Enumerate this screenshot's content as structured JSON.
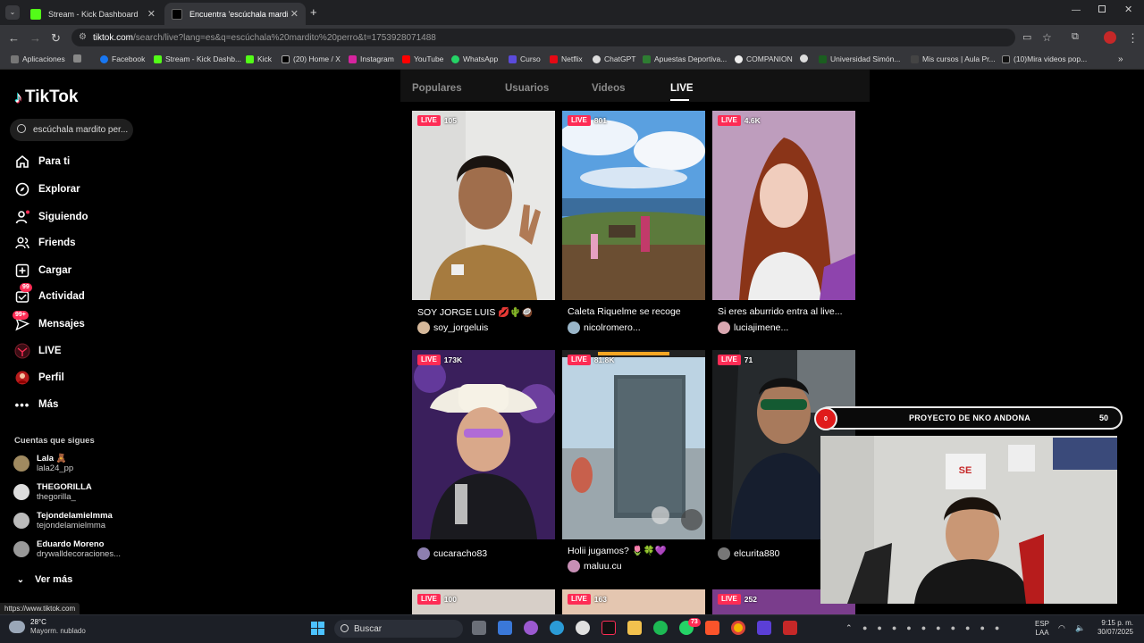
{
  "browser": {
    "tabs": [
      {
        "title": "Stream - Kick Dashboard",
        "active": false
      },
      {
        "title": "Encuentra 'escúchala mardito p...",
        "active": true
      }
    ],
    "url_host": "tiktok.com",
    "url_path": "/search/live?lang=es&q=escúchala%20mardito%20perro&t=1753928071488",
    "bookmarks": [
      "Aplicaciones",
      "Facebook",
      "Stream - Kick Dashb...",
      "Kick",
      "(20) Home / X",
      "Instagram",
      "YouTube",
      "WhatsApp",
      "Curso",
      "Netflix",
      "ChatGPT",
      "Apuestas Deportiva...",
      "COMPANION",
      "",
      "Universidad Simón...",
      "Mis cursos | Aula Pr...",
      "(10)Mira videos pop..."
    ]
  },
  "sidebar": {
    "logo": "TikTok",
    "search_value": "escúchala mardito per...",
    "nav": [
      {
        "label": "Para ti",
        "icon": "home-icon"
      },
      {
        "label": "Explorar",
        "icon": "compass-icon"
      },
      {
        "label": "Siguiendo",
        "icon": "following-icon"
      },
      {
        "label": "Friends",
        "icon": "friends-icon"
      },
      {
        "label": "Cargar",
        "icon": "upload-icon"
      },
      {
        "label": "Actividad",
        "icon": "activity-icon",
        "badge": "99"
      },
      {
        "label": "Mensajes",
        "icon": "messages-icon",
        "badge": "99+"
      },
      {
        "label": "LIVE",
        "icon": "live-icon"
      },
      {
        "label": "Perfil",
        "icon": "profile-icon"
      },
      {
        "label": "Más",
        "icon": "more-icon"
      }
    ],
    "following_title": "Cuentas que sigues",
    "following": [
      {
        "name": "Lala 🧸",
        "handle": "lala24_pp"
      },
      {
        "name": "THEGORILLA",
        "handle": "thegorilla_"
      },
      {
        "name": "Tejondelamielmma",
        "handle": "tejondelamielmma"
      },
      {
        "name": "Eduardo Moreno",
        "handle": "drywalldecoraciones..."
      }
    ],
    "see_more": "Ver más"
  },
  "content_tabs": [
    "Populares",
    "Usuarios",
    "Videos",
    "LIVE"
  ],
  "live_label": "LIVE",
  "cards": [
    {
      "viewers": "105",
      "title": "SOY JORGE LUIS 💋🌵🥥",
      "user": "soy_jorgeluis"
    },
    {
      "viewers": "801",
      "title": "Caleta Riquelme se recoge",
      "user": "nicolromero..."
    },
    {
      "viewers": "4.6K",
      "title": "Si eres aburrido entra al live...",
      "user": "luciajimene..."
    },
    {
      "viewers": "173K",
      "title": "",
      "user": "cucaracho83"
    },
    {
      "viewers": "81.8K",
      "title": "Holii jugamos? 🌷🍀💜",
      "user": "maluu.cu"
    },
    {
      "viewers": "71",
      "title": "",
      "user": "elcurita880"
    },
    {
      "viewers": "100",
      "title": "",
      "user": ""
    },
    {
      "viewers": "163",
      "title": "",
      "user": ""
    },
    {
      "viewers": "252",
      "title": "",
      "user": ""
    }
  ],
  "overlay": {
    "rec": "0",
    "title": "PROYECTO DE NKO ANDONA",
    "count": "50"
  },
  "status_url": "https://www.tiktok.com",
  "taskbar": {
    "weather_temp": "28°C",
    "weather_desc": "Mayorm. nublado",
    "search_placeholder": "Buscar",
    "lang1": "ESP",
    "lang2": "LAA",
    "time": "9:15 p. m.",
    "date": "30/07/2025",
    "notif_badge": "73"
  }
}
